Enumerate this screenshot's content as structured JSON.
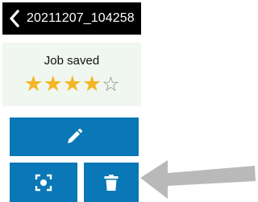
{
  "header": {
    "back_icon": "chevron-left-icon",
    "title": "20211207_104258"
  },
  "status": {
    "text": "Job saved"
  },
  "rating": {
    "value": 4,
    "max": 5,
    "full_star": "★",
    "empty_star": "☆",
    "color": "#f4b626"
  },
  "actions": {
    "edit_icon": "pencil-icon",
    "focus_icon": "focus-frame-icon",
    "delete_icon": "trash-icon",
    "button_color": "#0a77b6"
  },
  "annotation": {
    "pointer_icon": "gray-arrow-icon",
    "color": "#b9b9b9"
  }
}
